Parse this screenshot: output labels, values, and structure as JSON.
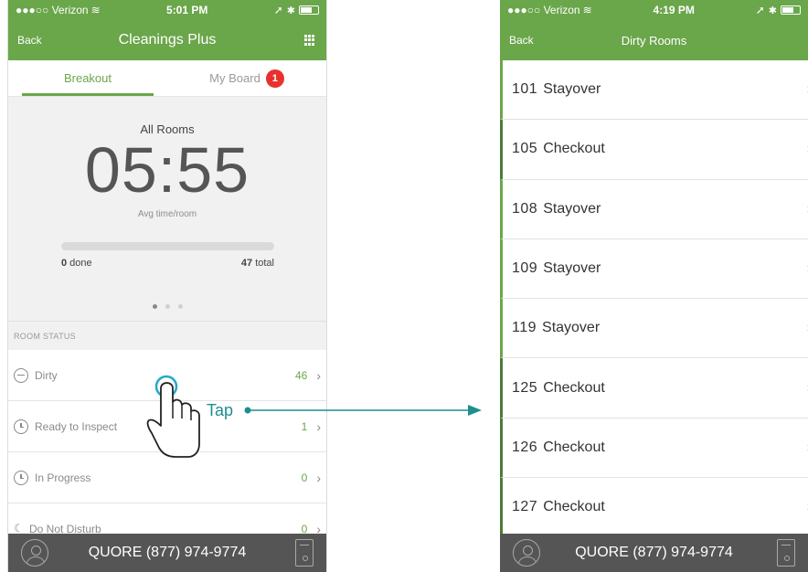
{
  "left_phone": {
    "status": {
      "carrier": "●●●○○ Verizon",
      "time": "5:01 PM"
    },
    "nav": {
      "back": "Back",
      "title": "Cleanings Plus"
    },
    "tabs": [
      {
        "label": "Breakout",
        "active": true
      },
      {
        "label": "My Board",
        "badge": "1"
      }
    ],
    "breakout": {
      "rooms_label": "All Rooms",
      "avg_time": "05:55",
      "avg_label": "Avg time/room",
      "progress_fraction": 0,
      "done_count": "0",
      "done_label": " done",
      "total_count": "47",
      "total_label": " total"
    },
    "section_header": "ROOM STATUS",
    "status_rows": [
      {
        "label": "Dirty",
        "count": "46",
        "icon": "minus-circle-icon"
      },
      {
        "label": "Ready to Inspect",
        "count": "1",
        "icon": "clock-icon"
      },
      {
        "label": "In Progress",
        "count": "0",
        "icon": "timer-icon"
      },
      {
        "label": "Do Not Disturb",
        "count": "0",
        "icon": "moon-icon"
      }
    ],
    "footer": {
      "phone": "QUORE (877) 974-9774"
    }
  },
  "annotation": {
    "tap_label": "Tap"
  },
  "right_phone": {
    "status": {
      "carrier": "●●●○○ Verizon",
      "time": "4:19 PM"
    },
    "nav": {
      "back": "Back",
      "title": "Dirty Rooms"
    },
    "rooms": [
      {
        "number": "101",
        "type": "Stayover"
      },
      {
        "number": "105",
        "type": "Checkout"
      },
      {
        "number": "108",
        "type": "Stayover"
      },
      {
        "number": "109",
        "type": "Stayover"
      },
      {
        "number": "119",
        "type": "Stayover"
      },
      {
        "number": "125",
        "type": "Checkout"
      },
      {
        "number": "126",
        "type": "Checkout"
      },
      {
        "number": "127",
        "type": "Checkout"
      }
    ],
    "footer": {
      "phone": "QUORE (877) 974-9774"
    }
  },
  "colors": {
    "brand_green": "#6aa64a",
    "badge_red": "#e8312f",
    "footer_gray": "#555555",
    "annotation_teal": "#1e8e8f"
  }
}
